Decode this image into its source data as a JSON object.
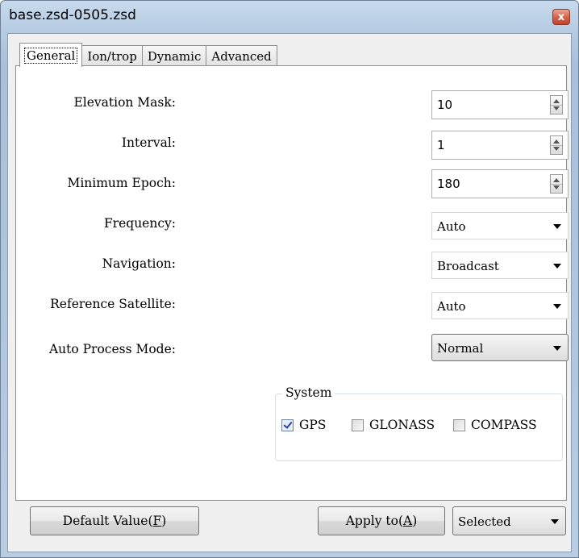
{
  "window": {
    "title": "base.zsd-0505.zsd",
    "close_glyph": "x"
  },
  "tabs": [
    {
      "label": "General",
      "active": true
    },
    {
      "label": "Ion/trop",
      "active": false
    },
    {
      "label": "Dynamic",
      "active": false
    },
    {
      "label": "Advanced",
      "active": false
    }
  ],
  "general": {
    "elevation_mask": {
      "label": "Elevation Mask:",
      "value": "10"
    },
    "interval": {
      "label": "Interval:",
      "value": "1"
    },
    "minimum_epoch": {
      "label": "Minimum Epoch:",
      "value": "180"
    },
    "frequency": {
      "label": "Frequency:",
      "value": "Auto"
    },
    "navigation": {
      "label": "Navigation:",
      "value": "Broadcast"
    },
    "reference_satellite": {
      "label": "Reference Satellite:",
      "value": "Auto"
    },
    "auto_process_mode": {
      "label": "Auto Process Mode:",
      "value": "Normal"
    },
    "system": {
      "title": "System",
      "options": [
        {
          "label": "GPS",
          "checked": true
        },
        {
          "label": "GLONASS",
          "checked": false
        },
        {
          "label": "COMPASS",
          "checked": false
        }
      ]
    }
  },
  "footer": {
    "default_value": {
      "text": "Default Value(",
      "key": "F",
      "close": ")"
    },
    "apply_to": {
      "text": "Apply to(",
      "key": "A",
      "close": ")"
    },
    "apply_target": "Selected"
  },
  "colors": {
    "title_bg": "#b9cde2",
    "client_bg": "#f0f0f0",
    "panel_bg": "#ffffff",
    "close_red": "#c94a33"
  }
}
